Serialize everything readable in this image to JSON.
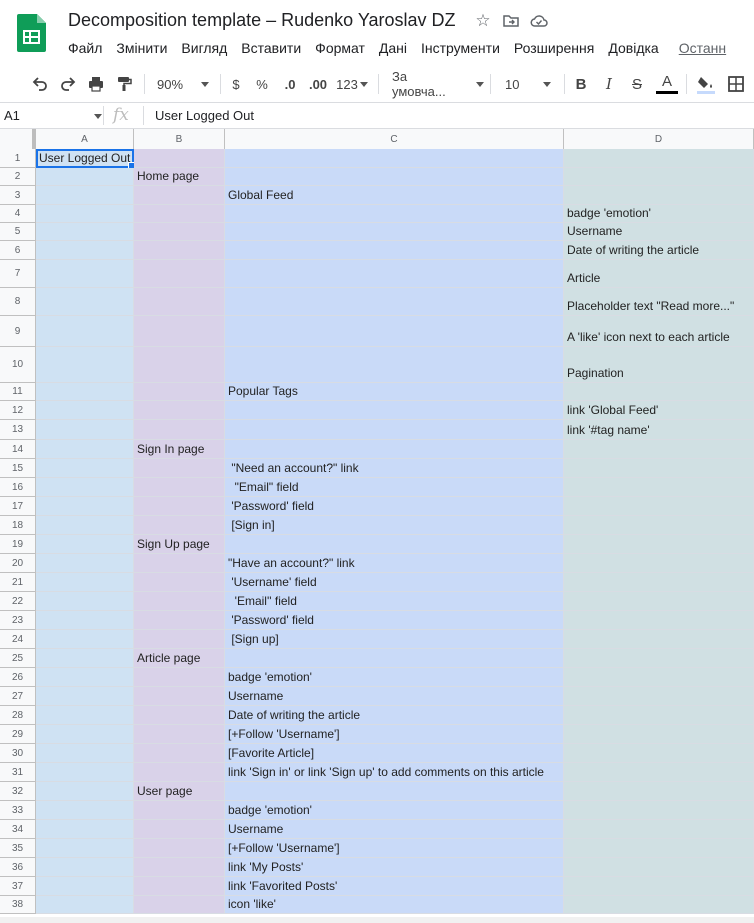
{
  "title": "Decomposition template – Rudenko Yaroslav DZ",
  "menu": [
    "Файл",
    "Змінити",
    "Вигляд",
    "Вставити",
    "Формат",
    "Дані",
    "Інструменти",
    "Розширення",
    "Довідка"
  ],
  "menu_last": "Останн",
  "toolbar": {
    "zoom": "90%",
    "currency": "$",
    "percent": "%",
    "dec_less": ".0",
    "dec_more": ".00",
    "format_more": "123",
    "font": "За умовча...",
    "font_size": "10",
    "bold": "B",
    "italic": "I",
    "strike": "S",
    "text_color": "A"
  },
  "formula_bar": {
    "cell_ref": "A1",
    "fx": "fx",
    "value": "User Logged Out"
  },
  "columns": [
    "A",
    "B",
    "C",
    "D"
  ],
  "colors": {
    "colA": "#cfe2f3",
    "colB": "#d9d2e9",
    "colC": "#c9daf8",
    "colD": "#d0e0e3",
    "selection": "#1a73e8",
    "logo": "#0f9d58"
  },
  "rows": [
    {
      "n": "1",
      "a": "User Logged Out",
      "b": "",
      "c": "",
      "d": ""
    },
    {
      "n": "2",
      "a": "",
      "b": "Home page",
      "c": "",
      "d": ""
    },
    {
      "n": "3",
      "a": "",
      "b": "",
      "c": "Global Feed",
      "d": ""
    },
    {
      "n": "4",
      "a": "",
      "b": "",
      "c": "",
      "d": "badge 'emotion'"
    },
    {
      "n": "5",
      "a": "",
      "b": "",
      "c": "",
      "d": "Username"
    },
    {
      "n": "6",
      "a": "",
      "b": "",
      "c": "",
      "d": "Date of writing the article"
    },
    {
      "n": "7",
      "a": "",
      "b": "",
      "c": "",
      "d": "Article"
    },
    {
      "n": "8",
      "a": "",
      "b": "",
      "c": "",
      "d": "Placeholder text \"Read more...\""
    },
    {
      "n": "9",
      "a": "",
      "b": "",
      "c": "",
      "d": "A 'like' icon next to each article"
    },
    {
      "n": "10",
      "a": "",
      "b": "",
      "c": "",
      "d": "Pagination"
    },
    {
      "n": "11",
      "a": "",
      "b": "",
      "c": "Popular Tags",
      "d": ""
    },
    {
      "n": "12",
      "a": "",
      "b": "",
      "c": "",
      "d": "link 'Global Feed'"
    },
    {
      "n": "13",
      "a": "",
      "b": "",
      "c": "",
      "d": "link '#tag name'"
    },
    {
      "n": "14",
      "a": "",
      "b": "Sign In page",
      "c": "",
      "d": ""
    },
    {
      "n": "15",
      "a": "",
      "b": "",
      "c": " \"Need an account?\" link",
      "d": ""
    },
    {
      "n": "16",
      "a": "",
      "b": "",
      "c": "  \"Email\" field",
      "d": ""
    },
    {
      "n": "17",
      "a": "",
      "b": "",
      "c": " 'Password' field",
      "d": ""
    },
    {
      "n": "18",
      "a": "",
      "b": "",
      "c": " [Sign in]",
      "d": ""
    },
    {
      "n": "19",
      "a": "",
      "b": "Sign Up page",
      "c": "",
      "d": ""
    },
    {
      "n": "20",
      "a": "",
      "b": "",
      "c": "\"Have an account?\" link",
      "d": ""
    },
    {
      "n": "21",
      "a": "",
      "b": "",
      "c": " 'Username' field",
      "d": ""
    },
    {
      "n": "22",
      "a": "",
      "b": "",
      "c": "  'Email'' field",
      "d": ""
    },
    {
      "n": "23",
      "a": "",
      "b": "",
      "c": " 'Password' field",
      "d": ""
    },
    {
      "n": "24",
      "a": "",
      "b": "",
      "c": " [Sign up]",
      "d": ""
    },
    {
      "n": "25",
      "a": "",
      "b": "Article page",
      "c": "",
      "d": ""
    },
    {
      "n": "26",
      "a": "",
      "b": "",
      "c": "badge 'emotion'",
      "d": ""
    },
    {
      "n": "27",
      "a": "",
      "b": "",
      "c": "Username",
      "d": ""
    },
    {
      "n": "28",
      "a": "",
      "b": "",
      "c": "Date of writing the article",
      "d": ""
    },
    {
      "n": "29",
      "a": "",
      "b": "",
      "c": "[+Follow 'Username']",
      "d": ""
    },
    {
      "n": "30",
      "a": "",
      "b": "",
      "c": "[Favorite Article]",
      "d": ""
    },
    {
      "n": "31",
      "a": "",
      "b": "",
      "c": "link 'Sign in' or link 'Sign up' to add comments on this article",
      "d": ""
    },
    {
      "n": "32",
      "a": "",
      "b": "User page",
      "c": "",
      "d": ""
    },
    {
      "n": "33",
      "a": "",
      "b": "",
      "c": "badge 'emotion'",
      "d": ""
    },
    {
      "n": "34",
      "a": "",
      "b": "",
      "c": "Username",
      "d": ""
    },
    {
      "n": "35",
      "a": "",
      "b": "",
      "c": "[+Follow 'Username']",
      "d": ""
    },
    {
      "n": "36",
      "a": "",
      "b": "",
      "c": "link 'My Posts'",
      "d": ""
    },
    {
      "n": "37",
      "a": "",
      "b": "",
      "c": "link 'Favorited Posts'",
      "d": ""
    },
    {
      "n": "38",
      "a": "",
      "b": "",
      "c": "icon 'like'",
      "d": ""
    }
  ]
}
